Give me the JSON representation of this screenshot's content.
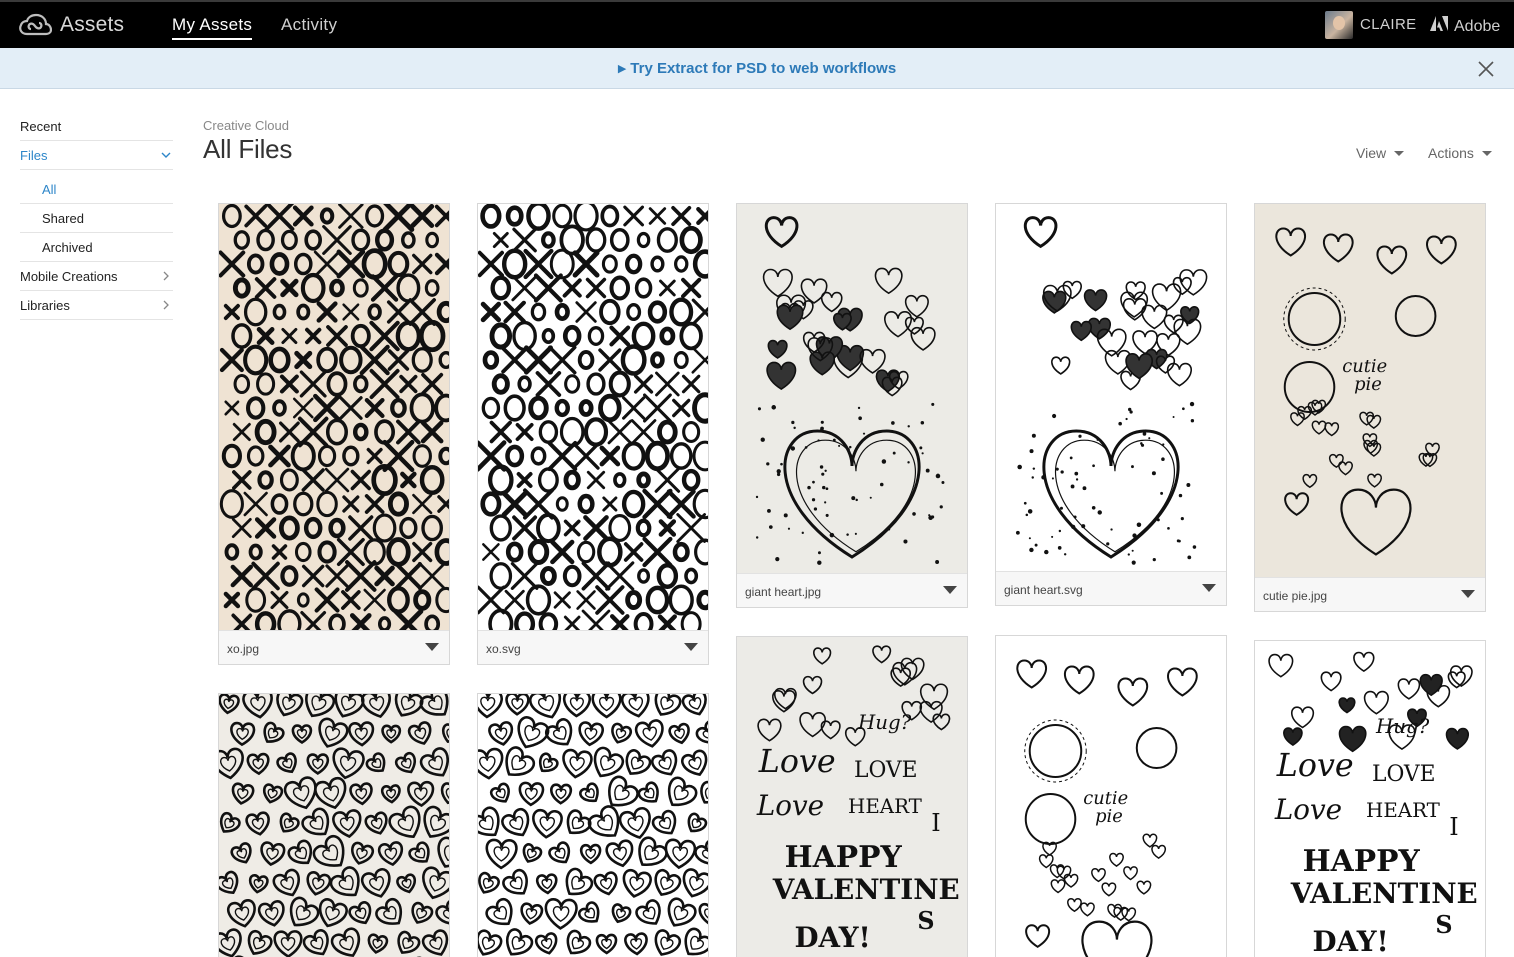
{
  "header": {
    "app_name": "Assets",
    "tabs": [
      {
        "label": "My Assets",
        "active": true
      },
      {
        "label": "Activity",
        "active": false
      }
    ],
    "user_name": "CLAIRE",
    "adobe_label": "Adobe"
  },
  "banner": {
    "link_text": "Try Extract for PSD to web workflows",
    "close_icon": "close-icon"
  },
  "sidebar": {
    "items": [
      {
        "label": "Recent"
      },
      {
        "label": "Files",
        "expanded": true
      },
      {
        "label": "All"
      },
      {
        "label": "Shared"
      },
      {
        "label": "Archived"
      },
      {
        "label": "Mobile Creations"
      },
      {
        "label": "Libraries"
      }
    ]
  },
  "main": {
    "breadcrumb": "Creative Cloud",
    "title": "All Files",
    "view_label": "View",
    "actions_label": "Actions"
  },
  "files": [
    {
      "name": "xo.jpg",
      "pattern": "xo",
      "background": "#efe3d3"
    },
    {
      "name": "xo.svg",
      "pattern": "xo",
      "background": "#ffffff"
    },
    {
      "name": "giant heart.jpg",
      "pattern": "giant-heart",
      "background": "#ecebe6"
    },
    {
      "name": "giant heart.svg",
      "pattern": "giant-heart",
      "background": "#ffffff"
    },
    {
      "name": "cutie pie.jpg",
      "pattern": "cutie-pie",
      "background": "#ebe6dc"
    },
    {
      "name": "",
      "pattern": "hearts",
      "background": "#efece6"
    },
    {
      "name": "",
      "pattern": "hearts",
      "background": "#ffffff"
    },
    {
      "name": "",
      "pattern": "valentine",
      "background": "#ecebe7"
    },
    {
      "name": "",
      "pattern": "cutie-pie",
      "background": "#ffffff"
    },
    {
      "name": "",
      "pattern": "valentine",
      "background": "#ffffff"
    }
  ],
  "drawing_text": {
    "cutie": "cutie",
    "pie": "pie",
    "hug": "Hug?",
    "love1": "Love",
    "love2": "LOVE",
    "love3": "Love",
    "heart": "HEART",
    "i": "I",
    "happy": "HAPPY",
    "valentine": "VALENTINE",
    "s": "S",
    "day": "DAY!"
  },
  "colors": {
    "topbar": "#000000",
    "banner_bg": "#e3eef7",
    "link_blue": "#2d7ab8",
    "active_blue": "#2d86c9"
  }
}
